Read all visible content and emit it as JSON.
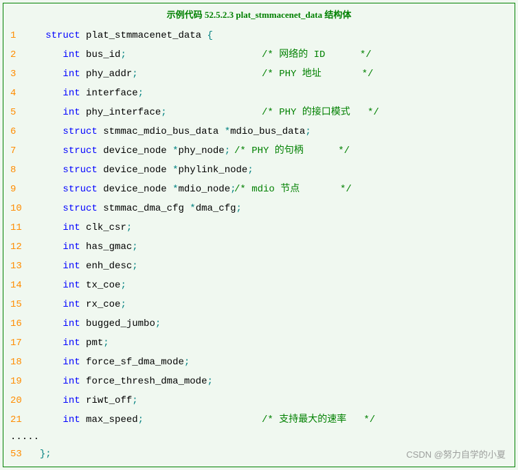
{
  "title": "示例代码 52.5.2.3 plat_stmmacenet_data 结构体",
  "watermark": "CSDN @努力自学的小夏",
  "dots": ".....",
  "lines": [
    {
      "n": "1",
      "indent": "   ",
      "tokens": [
        {
          "t": "kw",
          "v": "struct"
        },
        {
          "t": "sp",
          "v": " "
        },
        {
          "t": "ident",
          "v": "plat_stmmacenet_data "
        },
        {
          "t": "punct",
          "v": "{"
        }
      ]
    },
    {
      "n": "2",
      "indent": "      ",
      "tokens": [
        {
          "t": "kw",
          "v": "int"
        },
        {
          "t": "sp",
          "v": " "
        },
        {
          "t": "ident",
          "v": "bus_id"
        },
        {
          "t": "punct",
          "v": ";"
        }
      ],
      "comment": "/* 网络的 ID      */",
      "commentCol": 340
    },
    {
      "n": "3",
      "indent": "      ",
      "tokens": [
        {
          "t": "kw",
          "v": "int"
        },
        {
          "t": "sp",
          "v": " "
        },
        {
          "t": "ident",
          "v": "phy_addr"
        },
        {
          "t": "punct",
          "v": ";"
        }
      ],
      "comment": "/* PHY 地址       */",
      "commentCol": 340
    },
    {
      "n": "4",
      "indent": "      ",
      "tokens": [
        {
          "t": "kw",
          "v": "int"
        },
        {
          "t": "sp",
          "v": " "
        },
        {
          "t": "ident",
          "v": "interface"
        },
        {
          "t": "punct",
          "v": ";"
        }
      ]
    },
    {
      "n": "5",
      "indent": "      ",
      "tokens": [
        {
          "t": "kw",
          "v": "int"
        },
        {
          "t": "sp",
          "v": " "
        },
        {
          "t": "ident",
          "v": "phy_interface"
        },
        {
          "t": "punct",
          "v": ";"
        }
      ],
      "comment": "/* PHY 的接口模式   */",
      "commentCol": 340
    },
    {
      "n": "6",
      "indent": "      ",
      "tokens": [
        {
          "t": "kw",
          "v": "struct"
        },
        {
          "t": "sp",
          "v": " "
        },
        {
          "t": "ident",
          "v": "stmmac_mdio_bus_data "
        },
        {
          "t": "punct",
          "v": "*"
        },
        {
          "t": "ident",
          "v": "mdio_bus_data"
        },
        {
          "t": "punct",
          "v": ";"
        }
      ]
    },
    {
      "n": "7",
      "indent": "      ",
      "tokens": [
        {
          "t": "kw",
          "v": "struct"
        },
        {
          "t": "sp",
          "v": " "
        },
        {
          "t": "ident",
          "v": "device_node "
        },
        {
          "t": "punct",
          "v": "*"
        },
        {
          "t": "ident",
          "v": "phy_node"
        },
        {
          "t": "punct",
          "v": ";"
        }
      ],
      "comment": "/* PHY 的句柄      */",
      "commentCol": 300
    },
    {
      "n": "8",
      "indent": "      ",
      "tokens": [
        {
          "t": "kw",
          "v": "struct"
        },
        {
          "t": "sp",
          "v": " "
        },
        {
          "t": "ident",
          "v": "device_node "
        },
        {
          "t": "punct",
          "v": "*"
        },
        {
          "t": "ident",
          "v": "phylink_node"
        },
        {
          "t": "punct",
          "v": ";"
        }
      ]
    },
    {
      "n": "9",
      "indent": "      ",
      "tokens": [
        {
          "t": "kw",
          "v": "struct"
        },
        {
          "t": "sp",
          "v": " "
        },
        {
          "t": "ident",
          "v": "device_node "
        },
        {
          "t": "punct",
          "v": "*"
        },
        {
          "t": "ident",
          "v": "mdio_node"
        },
        {
          "t": "punct",
          "v": ";"
        }
      ],
      "comment": "/* mdio 节点       */",
      "commentCol": 300
    },
    {
      "n": "10",
      "indent": "      ",
      "tokens": [
        {
          "t": "kw",
          "v": "struct"
        },
        {
          "t": "sp",
          "v": " "
        },
        {
          "t": "ident",
          "v": "stmmac_dma_cfg "
        },
        {
          "t": "punct",
          "v": "*"
        },
        {
          "t": "ident",
          "v": "dma_cfg"
        },
        {
          "t": "punct",
          "v": ";"
        }
      ]
    },
    {
      "n": "11",
      "indent": "      ",
      "tokens": [
        {
          "t": "kw",
          "v": "int"
        },
        {
          "t": "sp",
          "v": " "
        },
        {
          "t": "ident",
          "v": "clk_csr"
        },
        {
          "t": "punct",
          "v": ";"
        }
      ]
    },
    {
      "n": "12",
      "indent": "      ",
      "tokens": [
        {
          "t": "kw",
          "v": "int"
        },
        {
          "t": "sp",
          "v": " "
        },
        {
          "t": "ident",
          "v": "has_gmac"
        },
        {
          "t": "punct",
          "v": ";"
        }
      ]
    },
    {
      "n": "13",
      "indent": "      ",
      "tokens": [
        {
          "t": "kw",
          "v": "int"
        },
        {
          "t": "sp",
          "v": " "
        },
        {
          "t": "ident",
          "v": "enh_desc"
        },
        {
          "t": "punct",
          "v": ";"
        }
      ]
    },
    {
      "n": "14",
      "indent": "      ",
      "tokens": [
        {
          "t": "kw",
          "v": "int"
        },
        {
          "t": "sp",
          "v": " "
        },
        {
          "t": "ident",
          "v": "tx_coe"
        },
        {
          "t": "punct",
          "v": ";"
        }
      ]
    },
    {
      "n": "15",
      "indent": "      ",
      "tokens": [
        {
          "t": "kw",
          "v": "int"
        },
        {
          "t": "sp",
          "v": " "
        },
        {
          "t": "ident",
          "v": "rx_coe"
        },
        {
          "t": "punct",
          "v": ";"
        }
      ]
    },
    {
      "n": "16",
      "indent": "      ",
      "tokens": [
        {
          "t": "kw",
          "v": "int"
        },
        {
          "t": "sp",
          "v": " "
        },
        {
          "t": "ident",
          "v": "bugged_jumbo"
        },
        {
          "t": "punct",
          "v": ";"
        }
      ]
    },
    {
      "n": "17",
      "indent": "      ",
      "tokens": [
        {
          "t": "kw",
          "v": "int"
        },
        {
          "t": "sp",
          "v": " "
        },
        {
          "t": "ident",
          "v": "pmt"
        },
        {
          "t": "punct",
          "v": ";"
        }
      ]
    },
    {
      "n": "18",
      "indent": "      ",
      "tokens": [
        {
          "t": "kw",
          "v": "int"
        },
        {
          "t": "sp",
          "v": " "
        },
        {
          "t": "ident",
          "v": "force_sf_dma_mode"
        },
        {
          "t": "punct",
          "v": ";"
        }
      ]
    },
    {
      "n": "19",
      "indent": "      ",
      "tokens": [
        {
          "t": "kw",
          "v": "int"
        },
        {
          "t": "sp",
          "v": " "
        },
        {
          "t": "ident",
          "v": "force_thresh_dma_mode"
        },
        {
          "t": "punct",
          "v": ";"
        }
      ]
    },
    {
      "n": "20",
      "indent": "      ",
      "tokens": [
        {
          "t": "kw",
          "v": "int"
        },
        {
          "t": "sp",
          "v": " "
        },
        {
          "t": "ident",
          "v": "riwt_off"
        },
        {
          "t": "punct",
          "v": ";"
        }
      ]
    },
    {
      "n": "21",
      "indent": "      ",
      "tokens": [
        {
          "t": "kw",
          "v": "int"
        },
        {
          "t": "sp",
          "v": " "
        },
        {
          "t": "ident",
          "v": "max_speed"
        },
        {
          "t": "punct",
          "v": ";"
        }
      ],
      "comment": "/* 支持最大的速率   */",
      "commentCol": 340
    }
  ],
  "lastLine": {
    "n": "53",
    "indent": "  ",
    "tokens": [
      {
        "t": "punct",
        "v": "};"
      }
    ]
  }
}
